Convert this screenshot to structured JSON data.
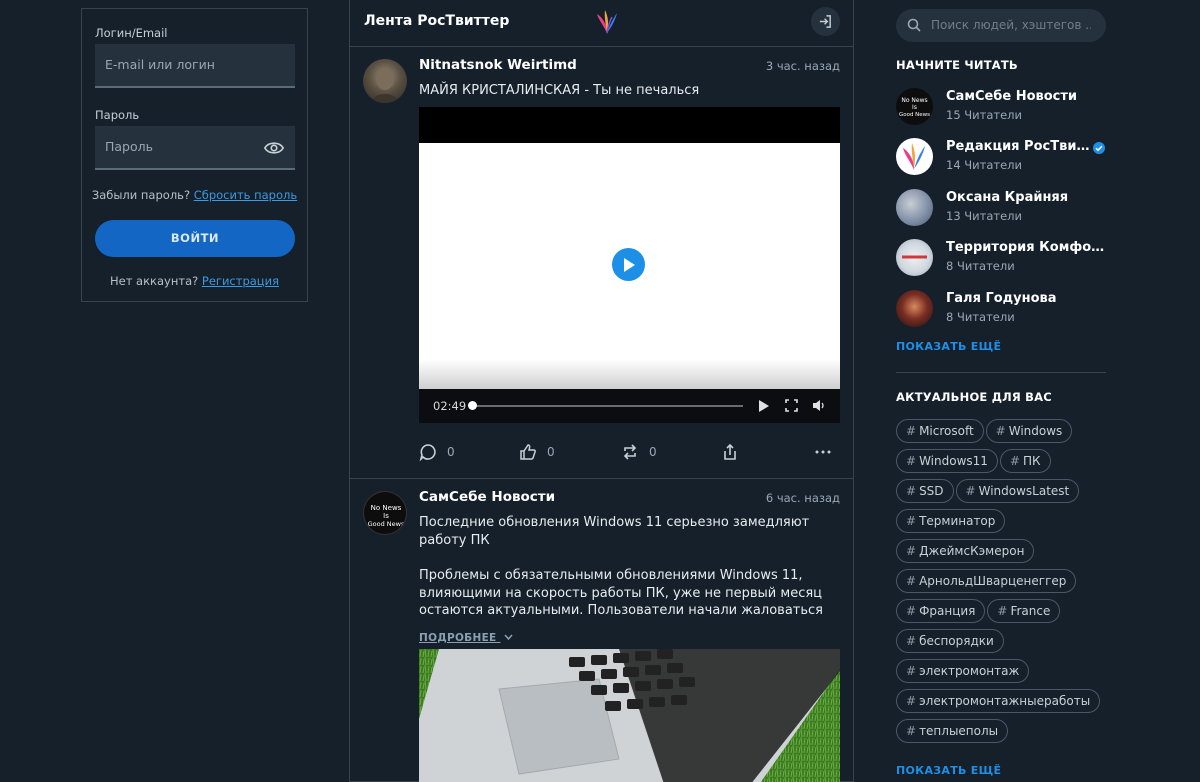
{
  "login": {
    "login_label": "Логин/Email",
    "login_placeholder": "E-mail или логин",
    "password_label": "Пароль",
    "password_placeholder": "Пароль",
    "forgot_text": "Забыли пароль?",
    "forgot_link": "Сбросить пароль",
    "submit_label": "ВОЙТИ",
    "no_account_text": "Нет аккаунта?",
    "register_link": "Регистрация"
  },
  "feed": {
    "title": "Лента РосТвиттер",
    "posts": [
      {
        "author": "Nitnatsnok Weirtimd",
        "time": "3 час. назад",
        "text": "МАЙЯ КРИСТАЛИНСКАЯ - Ты не печалься",
        "video_time": "02:49",
        "video_progress": 0.0,
        "comments": "0",
        "likes": "0",
        "reposts": "0"
      },
      {
        "author": "СамСебе Новости",
        "time": "6 час. назад",
        "text_1": "Последние обновления Windows 11 серьезно замедляют работу ПК",
        "text_2": "Проблемы с обязательными обновлениями Windows 11, влияющими на скорость работы ПК, уже не первый месяц остаются актуальными. Пользователи начали жаловаться на э...",
        "more_label": "ПОДРОБНЕЕ"
      }
    ]
  },
  "sidebar": {
    "search_placeholder": "Поиск людей, хэштегов ...",
    "follow_title": "НАЧНИТЕ ЧИТАТЬ",
    "recommendations": [
      {
        "name": "СамСебе Новости",
        "followers": "15 Читатели",
        "verified": false
      },
      {
        "name": "Редакция РосТвиттер",
        "followers": "14 Читатели",
        "verified": true
      },
      {
        "name": "Оксана Крайняя",
        "followers": "13 Читатели",
        "verified": false
      },
      {
        "name": "Территория Комфорта",
        "followers": "8 Читатели",
        "verified": false
      },
      {
        "name": "Галя Годунова",
        "followers": "8 Читатели",
        "verified": false
      }
    ],
    "show_more": "ПОКАЗАТЬ ЕЩЁ",
    "trends_title": "АКТУАЛЬНОЕ ДЛЯ ВАС",
    "tags": [
      "Microsoft",
      "Windows",
      "Windows11",
      "ПК",
      "SSD",
      "WindowsLatest",
      "Терминатор",
      "ДжеймсКэмерон",
      "АрнольдШварценеггер",
      "Франция",
      "France",
      "беспорядки",
      "электромонтаж",
      "электромонтажныеработы",
      "теплыеполы"
    ],
    "show_more_2": "ПОКАЗАТЬ ЕЩЁ"
  },
  "colors": {
    "accent": "#1d8fe6",
    "button": "#1366c4",
    "bg": "#15202b",
    "border": "#38444d"
  }
}
